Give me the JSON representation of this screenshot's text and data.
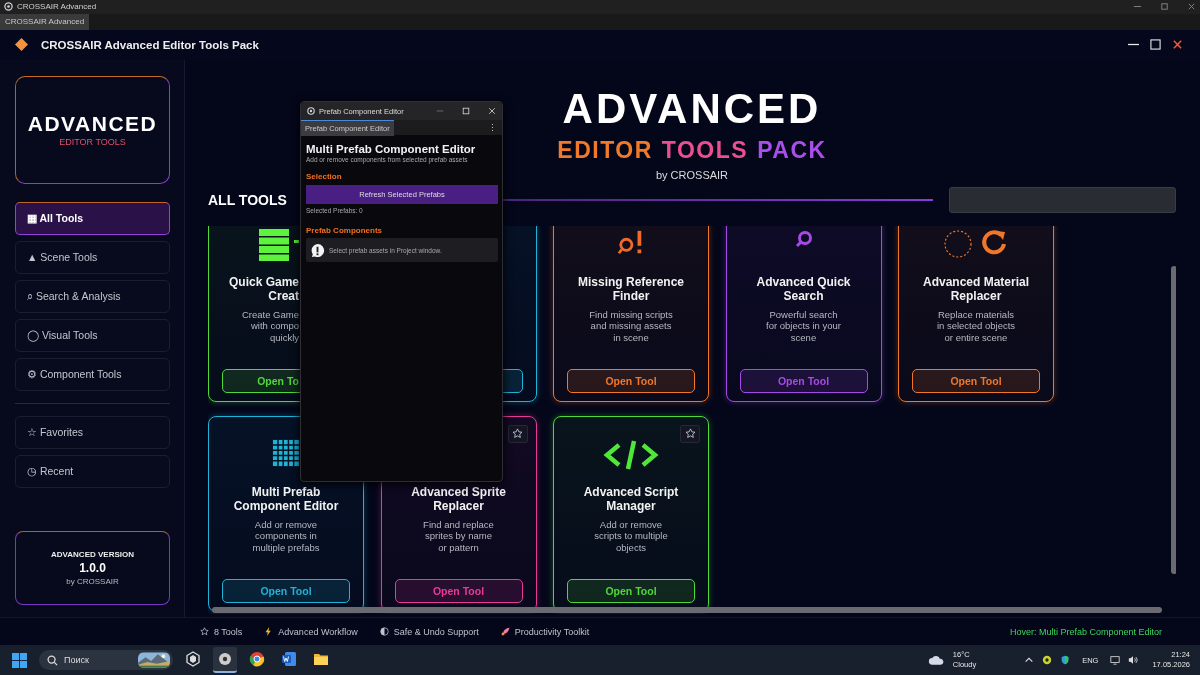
{
  "os_window": {
    "title": "CROSSAIR Advanced",
    "tab": "CROSSAIR Advanced"
  },
  "app": {
    "title": "CROSSAIR Advanced Editor Tools Pack"
  },
  "sidebar": {
    "logo": {
      "title": "ADVANCED",
      "subtitle": "EDITOR TOOLS"
    },
    "nav": [
      {
        "icon": "▦",
        "label": "All Tools",
        "selected": true
      },
      {
        "icon": "▲",
        "label": "Scene Tools",
        "selected": false
      },
      {
        "icon": "⌕",
        "label": "Search & Analysis",
        "selected": false
      },
      {
        "icon": "◯",
        "label": "Visual Tools",
        "selected": false
      },
      {
        "icon": "⚙",
        "label": "Component Tools",
        "selected": false
      }
    ],
    "extra": [
      {
        "icon": "☆",
        "label": "Favorites",
        "selected": false
      },
      {
        "icon": "◷",
        "label": "Recent",
        "selected": false
      }
    ],
    "version": {
      "label": "ADVANCED VERSION",
      "number": "1.0.0",
      "by": "by CROSSAIR"
    }
  },
  "hero": {
    "title": "ADVANCED",
    "subtitle": [
      {
        "text": "EDITOR",
        "color": "#f07a2a"
      },
      {
        "text": "TOOLS",
        "color": "#ec4f8f"
      },
      {
        "text": "PACK",
        "color": "#a94ee8"
      }
    ],
    "by": "by CROSSAIR"
  },
  "section": {
    "title": "ALL TOOLS"
  },
  "tools": [
    {
      "kind": "partial",
      "color": "#4fd83a",
      "title_lines": [
        "Quick Game",
        "Creat"
      ],
      "desc_lines": [
        "Create Game",
        "with compo",
        "quickly"
      ],
      "button": "Open To"
    },
    {
      "kind": "hidden",
      "color": "#1fb3d8"
    },
    {
      "kind": "full",
      "color": "#f0772a",
      "title_lines": [
        "Missing Reference",
        "Finder"
      ],
      "desc_lines": [
        "Find missing scripts",
        "and missing assets",
        "in scene"
      ],
      "button": "Open Tool"
    },
    {
      "kind": "full",
      "color": "#a64ae6",
      "title_lines": [
        "Advanced Quick",
        "Search"
      ],
      "desc_lines": [
        "Powerful search",
        "for objects in your",
        "scene"
      ],
      "button": "Open Tool"
    },
    {
      "kind": "full",
      "color": "#f0772a",
      "title_lines": [
        "Advanced Material",
        "Replacer"
      ],
      "desc_lines": [
        "Replace materials",
        "in selected objects",
        "or entire scene"
      ],
      "button": "Open Tool"
    },
    {
      "kind": "full",
      "color": "#1fb3d8",
      "title_lines": [
        "Multi Prefab",
        "Component Editor"
      ],
      "desc_lines": [
        "Add or remove",
        "components in",
        "multiple prefabs"
      ],
      "button": "Open Tool"
    },
    {
      "kind": "full",
      "color": "#e8399a",
      "title_lines": [
        "Advanced Sprite",
        "Replacer"
      ],
      "desc_lines": [
        "Find and replace",
        "sprites by name",
        "or pattern"
      ],
      "button": "Open Tool",
      "favorite": false
    },
    {
      "kind": "full",
      "color": "#4fd83a",
      "title_lines": [
        "Advanced Script",
        "Manager"
      ],
      "desc_lines": [
        "Add or remove",
        "scripts to multiple",
        "objects"
      ],
      "button": "Open Tool",
      "favorite": false
    }
  ],
  "footer": {
    "items": [
      "8 Tools",
      "Advanced Workflow",
      "Safe & Undo Support",
      "Productivity Toolkit"
    ],
    "hover": "Hover: Multi Prefab Component Editor"
  },
  "tool_window": {
    "title": "Prefab Component Editor",
    "tab": "Prefab Component Editor",
    "menu": "⋮",
    "heading": "Multi Prefab Component Editor",
    "description": "Add or remove components from selected prefab assets",
    "selection_title": "Selection",
    "refresh_button": "Refresh Selected Prefabs",
    "selected_count": "Selected Prefabs: 0",
    "components_title": "Prefab Components",
    "info": "Select prefab assets in Project window."
  },
  "taskbar": {
    "search_placeholder": "Поиск",
    "apps": [
      {
        "selected": false
      },
      {
        "selected": true
      },
      {
        "selected": false
      },
      {
        "selected": false
      },
      {
        "selected": false
      }
    ],
    "weather": {
      "temp": "16°C",
      "condition": "Cloudy"
    },
    "language": "ENG",
    "time": "21:24",
    "date": "17.05.2026"
  }
}
